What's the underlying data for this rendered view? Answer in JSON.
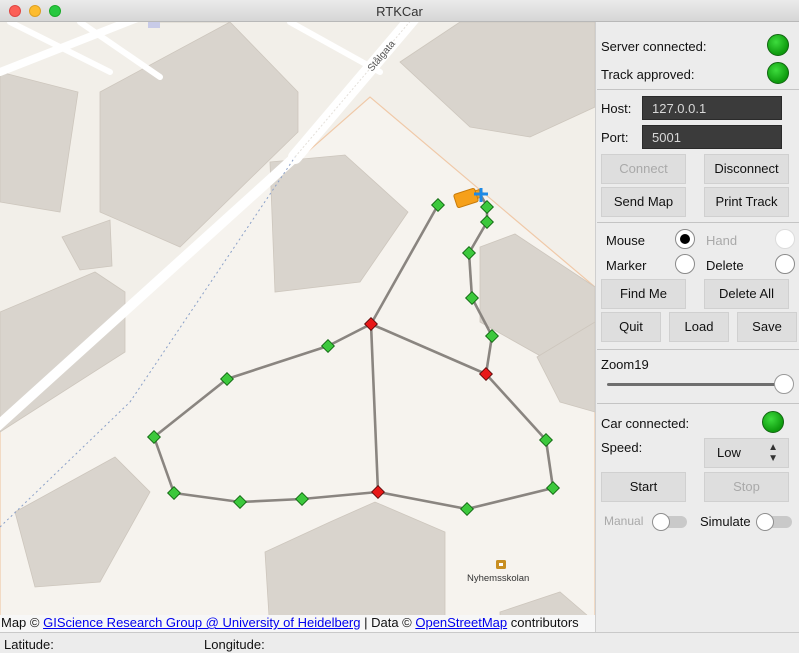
{
  "window": {
    "title": "RTKCar"
  },
  "map": {
    "street_label": "Stålgata",
    "poi_label": "Nyhemsskolan",
    "attribution": {
      "prefix": "Map © ",
      "link1": "GIScience Research Group @ University of Heidelberg",
      "middle": " | Data © ",
      "link2": "OpenStreetMap",
      "suffix": " contributors"
    }
  },
  "status": {
    "server_label": "Server connected:",
    "track_label": "Track approved:",
    "car_label": "Car connected:"
  },
  "connection": {
    "host_label": "Host:",
    "host_value": "127.0.0.1",
    "port_label": "Port:",
    "port_value": "5001",
    "connect": "Connect",
    "disconnect": "Disconnect",
    "send_map": "Send Map",
    "print_track": "Print Track"
  },
  "tools": {
    "mouse": "Mouse",
    "hand": "Hand",
    "marker": "Marker",
    "delete": "Delete",
    "find_me": "Find Me",
    "delete_all": "Delete All",
    "quit": "Quit",
    "load": "Load",
    "save": "Save"
  },
  "zoom": {
    "label": "Zoom19",
    "value": 19
  },
  "car": {
    "speed_label": "Speed:",
    "speed_value": "Low",
    "start": "Start",
    "stop": "Stop",
    "manual": "Manual",
    "simulate": "Simulate"
  },
  "statusbar": {
    "latitude": "Latitude:",
    "longitude": "Longitude:"
  },
  "colors": {
    "led_on": "#14b414",
    "waypoint": "#3cc83c",
    "junction": "#e81818",
    "track_line": "#8a8580",
    "car": "#f6a01a"
  }
}
